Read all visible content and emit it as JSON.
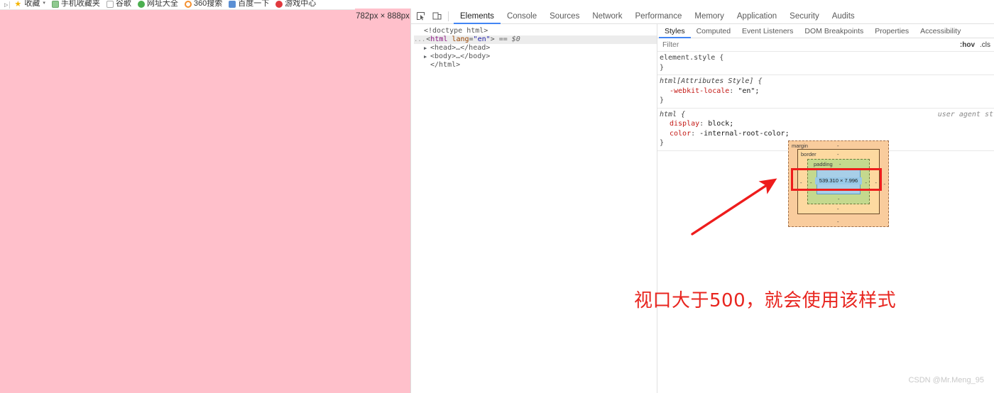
{
  "bookmarks": {
    "items": [
      {
        "label": "收藏",
        "icon": "star-icon",
        "has_caret": true
      },
      {
        "label": "手机收藏夹",
        "icon": "folder-icon",
        "has_caret": false
      },
      {
        "label": "谷歌",
        "icon": "square-icon",
        "has_caret": false
      },
      {
        "label": "网址大全",
        "icon": "green-dot-icon",
        "has_caret": false
      },
      {
        "label": "360搜索",
        "icon": "orange-ring-icon",
        "has_caret": false
      },
      {
        "label": "百度一下",
        "icon": "blue-square-icon",
        "has_caret": false
      },
      {
        "label": "游戏中心",
        "icon": "red-circle-icon",
        "has_caret": false
      }
    ]
  },
  "viewport": {
    "size_label": "782px × 888px",
    "background_color": "#ffc0cb"
  },
  "devtools": {
    "toolbar": {
      "inspect_icon": "inspect-element-icon",
      "device_icon": "device-toolbar-icon",
      "tabs": [
        {
          "label": "Elements",
          "active": true
        },
        {
          "label": "Console",
          "active": false
        },
        {
          "label": "Sources",
          "active": false
        },
        {
          "label": "Network",
          "active": false
        },
        {
          "label": "Performance",
          "active": false
        },
        {
          "label": "Memory",
          "active": false
        },
        {
          "label": "Application",
          "active": false
        },
        {
          "label": "Security",
          "active": false
        },
        {
          "label": "Audits",
          "active": false
        }
      ]
    },
    "dom_tree": {
      "doctype": "<!doctype html>",
      "html_open_prefix": "...",
      "html_tag": "html",
      "html_attr_name": "lang",
      "html_attr_value": "\"en\"",
      "html_selected_marker": "== $0",
      "head_line": "<head>…</head>",
      "body_line": "<body>…</body>",
      "html_close": "</html>"
    },
    "styles": {
      "tabs": [
        {
          "label": "Styles",
          "active": true
        },
        {
          "label": "Computed",
          "active": false
        },
        {
          "label": "Event Listeners",
          "active": false
        },
        {
          "label": "DOM Breakpoints",
          "active": false
        },
        {
          "label": "Properties",
          "active": false
        },
        {
          "label": "Accessibility",
          "active": false
        }
      ],
      "filter_placeholder": "Filter",
      "filter_value": "",
      "hov_label": ":hov",
      "cls_label": ".cls",
      "rules": [
        {
          "selector": "element.style {",
          "close": "}",
          "italic": false,
          "origin": "",
          "declarations": []
        },
        {
          "selector": "html[Attributes Style] {",
          "close": "}",
          "italic": true,
          "origin": "",
          "declarations": [
            {
              "property": "-webkit-locale",
              "value": "\"en\";"
            }
          ]
        },
        {
          "selector": "html {",
          "close": "}",
          "italic": true,
          "origin": "user agent st",
          "declarations": [
            {
              "property": "display",
              "value": "block;"
            },
            {
              "property": "color",
              "value": "-internal-root-color;"
            }
          ]
        }
      ],
      "box_model": {
        "margin_label": "margin",
        "border_label": "border",
        "padding_label": "padding",
        "content_dimensions": "539.310 × 7.996",
        "dash": "-",
        "colors": {
          "margin": "#f9cc9d",
          "border": "#fdd9a0",
          "padding": "#c4d98e",
          "content": "#a8cfe8"
        }
      }
    }
  },
  "annotations": {
    "highlight_color": "#ee1c1c",
    "arrow": "red-arrow-icon",
    "text": "视口大于500，就会使用该样式"
  },
  "watermark": "CSDN @Mr.Meng_95"
}
